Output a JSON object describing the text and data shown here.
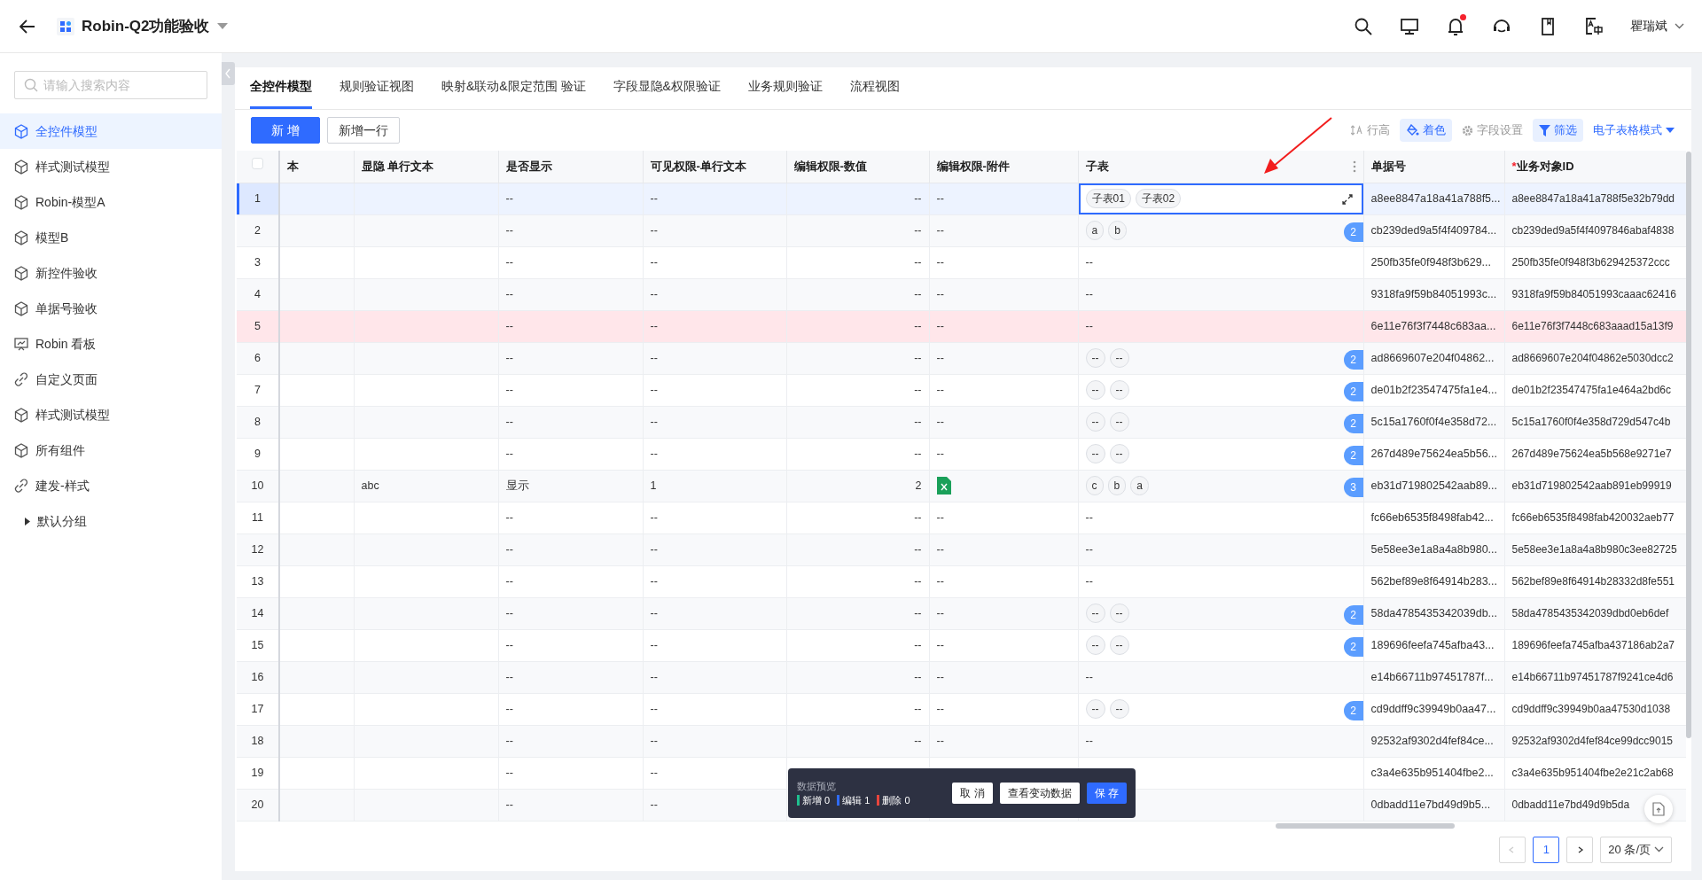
{
  "header": {
    "title": "Robin-Q2功能验收",
    "user": "瞿瑞斌",
    "notification_dot": true
  },
  "sidebar": {
    "search": {
      "placeholder": "请输入搜索内容"
    },
    "items": [
      {
        "label": "全控件模型",
        "kind": "model",
        "selected": true
      },
      {
        "label": "样式测试模型",
        "kind": "model",
        "selected": false
      },
      {
        "label": "Robin-模型A",
        "kind": "model",
        "selected": false
      },
      {
        "label": "模型B",
        "kind": "model",
        "selected": false
      },
      {
        "label": "新控件验收",
        "kind": "model",
        "selected": false
      },
      {
        "label": "单据号验收",
        "kind": "model",
        "selected": false
      },
      {
        "label": "Robin 看板",
        "kind": "board",
        "selected": false
      },
      {
        "label": "自定义页面",
        "kind": "page",
        "selected": false
      },
      {
        "label": "样式测试模型",
        "kind": "model",
        "selected": false
      },
      {
        "label": "所有组件",
        "kind": "model",
        "selected": false
      },
      {
        "label": "建发-样式",
        "kind": "page",
        "selected": false
      }
    ],
    "group": {
      "label": "默认分组",
      "expanded": false
    }
  },
  "tabs": [
    {
      "label": "全控件模型",
      "selected": true
    },
    {
      "label": "规则验证视图",
      "selected": false
    },
    {
      "label": "映射&联动&限定范围 验证",
      "selected": false
    },
    {
      "label": "字段显隐&权限验证",
      "selected": false
    },
    {
      "label": "业务规则验证",
      "selected": false
    },
    {
      "label": "流程视图",
      "selected": false
    }
  ],
  "buttons": [
    {
      "label": "新 增",
      "kind": "primary"
    },
    {
      "label": "新增一行",
      "kind": "default"
    }
  ],
  "tools": [
    {
      "label": "行高",
      "kind": "rowheight",
      "active": false
    },
    {
      "label": "着色",
      "kind": "paint",
      "active": true
    },
    {
      "label": "字段设置",
      "kind": "gear",
      "active": false
    },
    {
      "label": "筛选",
      "kind": "filter",
      "active": true
    },
    {
      "label": "电子表格模式",
      "kind": "dropdown",
      "active": false
    }
  ],
  "table": {
    "select_all_checked": false,
    "columns": [
      {
        "label": "本"
      },
      {
        "label": "显隐 单行文本"
      },
      {
        "label": "是否显示"
      },
      {
        "label": "可见权限-单行文本"
      },
      {
        "label": "编辑权限-数值"
      },
      {
        "label": "编辑权限-附件"
      },
      {
        "label": "子表",
        "menu": true
      },
      {
        "label": "单据号"
      },
      {
        "label": "业务对象ID",
        "required_mark": "*"
      }
    ],
    "rows": [
      {
        "no": "1",
        "selected": true,
        "error": false,
        "shown": "--",
        "visible_text": "--",
        "number_value": "--",
        "attachment": {
          "kind": "text",
          "text": "--"
        },
        "subtable": {
          "chips": [
            "子表01",
            "子表02"
          ],
          "editing": true
        },
        "doc_no": "a8ee8847a18a41a788f5...",
        "object_id": "a8ee8847a18a41a788f5e32b79dd"
      },
      {
        "no": "2",
        "selected": false,
        "error": false,
        "shown": "--",
        "visible_text": "--",
        "number_value": "--",
        "attachment": {
          "kind": "text",
          "text": "--"
        },
        "subtable": {
          "chips": [
            "a",
            "b"
          ],
          "count": "2",
          "editing": false
        },
        "doc_no": "cb239ded9a5f4f409784...",
        "object_id": "cb239ded9a5f4f4097846abaf4838"
      },
      {
        "no": "3",
        "selected": false,
        "error": false,
        "shown": "--",
        "visible_text": "--",
        "number_value": "--",
        "attachment": {
          "kind": "text",
          "text": "--"
        },
        "subtable": {
          "text": "--",
          "editing": false
        },
        "doc_no": "250fb35fe0f948f3b629...",
        "object_id": "250fb35fe0f948f3b629425372ccc"
      },
      {
        "no": "4",
        "selected": false,
        "error": false,
        "shown": "--",
        "visible_text": "--",
        "number_value": "--",
        "attachment": {
          "kind": "text",
          "text": "--"
        },
        "subtable": {
          "text": "--",
          "editing": false
        },
        "doc_no": "9318fa9f59b84051993c...",
        "object_id": "9318fa9f59b84051993caaac62416"
      },
      {
        "no": "5",
        "selected": false,
        "error": true,
        "shown": "--",
        "visible_text": "--",
        "number_value": "--",
        "attachment": {
          "kind": "text",
          "text": "--"
        },
        "subtable": {
          "text": "--",
          "editing": false
        },
        "doc_no": "6e11e76f3f7448c683aa...",
        "object_id": "6e11e76f3f7448c683aaad15a13f9"
      },
      {
        "no": "6",
        "selected": false,
        "error": false,
        "shown": "--",
        "visible_text": "--",
        "number_value": "--",
        "attachment": {
          "kind": "text",
          "text": "--"
        },
        "subtable": {
          "chips": [
            "--",
            "--"
          ],
          "count": "2",
          "editing": false
        },
        "doc_no": "ad8669607e204f04862...",
        "object_id": "ad8669607e204f04862e5030dcc2"
      },
      {
        "no": "7",
        "selected": false,
        "error": false,
        "shown": "--",
        "visible_text": "--",
        "number_value": "--",
        "attachment": {
          "kind": "text",
          "text": "--"
        },
        "subtable": {
          "chips": [
            "--",
            "--"
          ],
          "count": "2",
          "editing": false
        },
        "doc_no": "de01b2f23547475fa1e4...",
        "object_id": "de01b2f23547475fa1e464a2bd6c"
      },
      {
        "no": "8",
        "selected": false,
        "error": false,
        "shown": "--",
        "visible_text": "--",
        "number_value": "--",
        "attachment": {
          "kind": "text",
          "text": "--"
        },
        "subtable": {
          "chips": [
            "--",
            "--"
          ],
          "count": "2",
          "editing": false
        },
        "doc_no": "5c15a1760f0f4e358d72...",
        "object_id": "5c15a1760f0f4e358d729d547c4b"
      },
      {
        "no": "9",
        "selected": false,
        "error": false,
        "shown": "--",
        "visible_text": "--",
        "number_value": "--",
        "attachment": {
          "kind": "text",
          "text": "--"
        },
        "subtable": {
          "chips": [
            "--",
            "--"
          ],
          "count": "2",
          "editing": false
        },
        "doc_no": "267d489e75624ea5b56...",
        "object_id": "267d489e75624ea5b568e9271e7"
      },
      {
        "no": "10",
        "selected": false,
        "error": false,
        "text": "abc",
        "shown": "显示",
        "visible_text": "1",
        "number_value": "2",
        "attachment": {
          "kind": "file"
        },
        "subtable": {
          "chips": [
            "c",
            "b",
            "a"
          ],
          "count": "3",
          "editing": false
        },
        "doc_no": "eb31d719802542aab89...",
        "object_id": "eb31d719802542aab891eb99919"
      },
      {
        "no": "11",
        "selected": false,
        "error": false,
        "shown": "--",
        "visible_text": "--",
        "number_value": "--",
        "attachment": {
          "kind": "text",
          "text": "--"
        },
        "subtable": {
          "text": "--",
          "editing": false
        },
        "doc_no": "fc66eb6535f8498fab42...",
        "object_id": "fc66eb6535f8498fab420032aeb77"
      },
      {
        "no": "12",
        "selected": false,
        "error": false,
        "shown": "--",
        "visible_text": "--",
        "number_value": "--",
        "attachment": {
          "kind": "text",
          "text": "--"
        },
        "subtable": {
          "text": "--",
          "editing": false
        },
        "doc_no": "5e58ee3e1a8a4a8b980...",
        "object_id": "5e58ee3e1a8a4a8b980c3ee82725"
      },
      {
        "no": "13",
        "selected": false,
        "error": false,
        "shown": "--",
        "visible_text": "--",
        "number_value": "--",
        "attachment": {
          "kind": "text",
          "text": "--"
        },
        "subtable": {
          "text": "--",
          "editing": false
        },
        "doc_no": "562bef89e8f64914b283...",
        "object_id": "562bef89e8f64914b28332d8fe551"
      },
      {
        "no": "14",
        "selected": false,
        "error": false,
        "shown": "--",
        "visible_text": "--",
        "number_value": "--",
        "attachment": {
          "kind": "text",
          "text": "--"
        },
        "subtable": {
          "chips": [
            "--",
            "--"
          ],
          "count": "2",
          "editing": false
        },
        "doc_no": "58da4785435342039db...",
        "object_id": "58da4785435342039dbd0eb6def"
      },
      {
        "no": "15",
        "selected": false,
        "error": false,
        "shown": "--",
        "visible_text": "--",
        "number_value": "--",
        "attachment": {
          "kind": "text",
          "text": "--"
        },
        "subtable": {
          "chips": [
            "--",
            "--"
          ],
          "count": "2",
          "editing": false
        },
        "doc_no": "189696feefa745afba43...",
        "object_id": "189696feefa745afba437186ab2a7"
      },
      {
        "no": "16",
        "selected": false,
        "error": false,
        "shown": "--",
        "visible_text": "--",
        "number_value": "--",
        "attachment": {
          "kind": "text",
          "text": "--"
        },
        "subtable": {
          "text": "--",
          "editing": false
        },
        "doc_no": "e14b66711b97451787f...",
        "object_id": "e14b66711b97451787f9241ce4d6"
      },
      {
        "no": "17",
        "selected": false,
        "error": false,
        "shown": "--",
        "visible_text": "--",
        "number_value": "--",
        "attachment": {
          "kind": "text",
          "text": "--"
        },
        "subtable": {
          "chips": [
            "--",
            "--"
          ],
          "count": "2",
          "editing": false
        },
        "doc_no": "cd9ddff9c39949b0aa47...",
        "object_id": "cd9ddff9c39949b0aa47530d1038"
      },
      {
        "no": "18",
        "selected": false,
        "error": false,
        "shown": "--",
        "visible_text": "--",
        "number_value": "--",
        "attachment": {
          "kind": "text",
          "text": "--"
        },
        "subtable": {
          "text": "--",
          "editing": false
        },
        "doc_no": "92532af9302d4fef84ce...",
        "object_id": "92532af9302d4fef84ce99dcc9015"
      },
      {
        "no": "19",
        "selected": false,
        "error": false,
        "shown": "--",
        "visible_text": "--",
        "doc_no": "c3a4e635b951404fbe2...",
        "object_id": "c3a4e635b951404fbe2e21c2ab68"
      },
      {
        "no": "20",
        "selected": false,
        "error": false,
        "shown": "--",
        "visible_text": "--",
        "doc_no": "0dbadd11e7bd49d9b5...",
        "object_id": "0dbadd11e7bd49d9b5da"
      }
    ]
  },
  "preview": {
    "title": "数据预览",
    "stats": [
      {
        "label": "新增 0",
        "color": "#1fbf8f"
      },
      {
        "label": "编辑 1",
        "color": "#2f6bff"
      },
      {
        "label": "删除 0",
        "color": "#e8453c"
      }
    ],
    "buttons": [
      {
        "label": "取 消",
        "kind": "default"
      },
      {
        "label": "查看变动数据",
        "kind": "default"
      },
      {
        "label": "保 存",
        "kind": "primary"
      }
    ]
  },
  "pagination": {
    "prev_disabled": true,
    "next_disabled": false,
    "pages": [
      {
        "label": "1",
        "selected": true
      }
    ],
    "page_size": "20 条/页"
  }
}
